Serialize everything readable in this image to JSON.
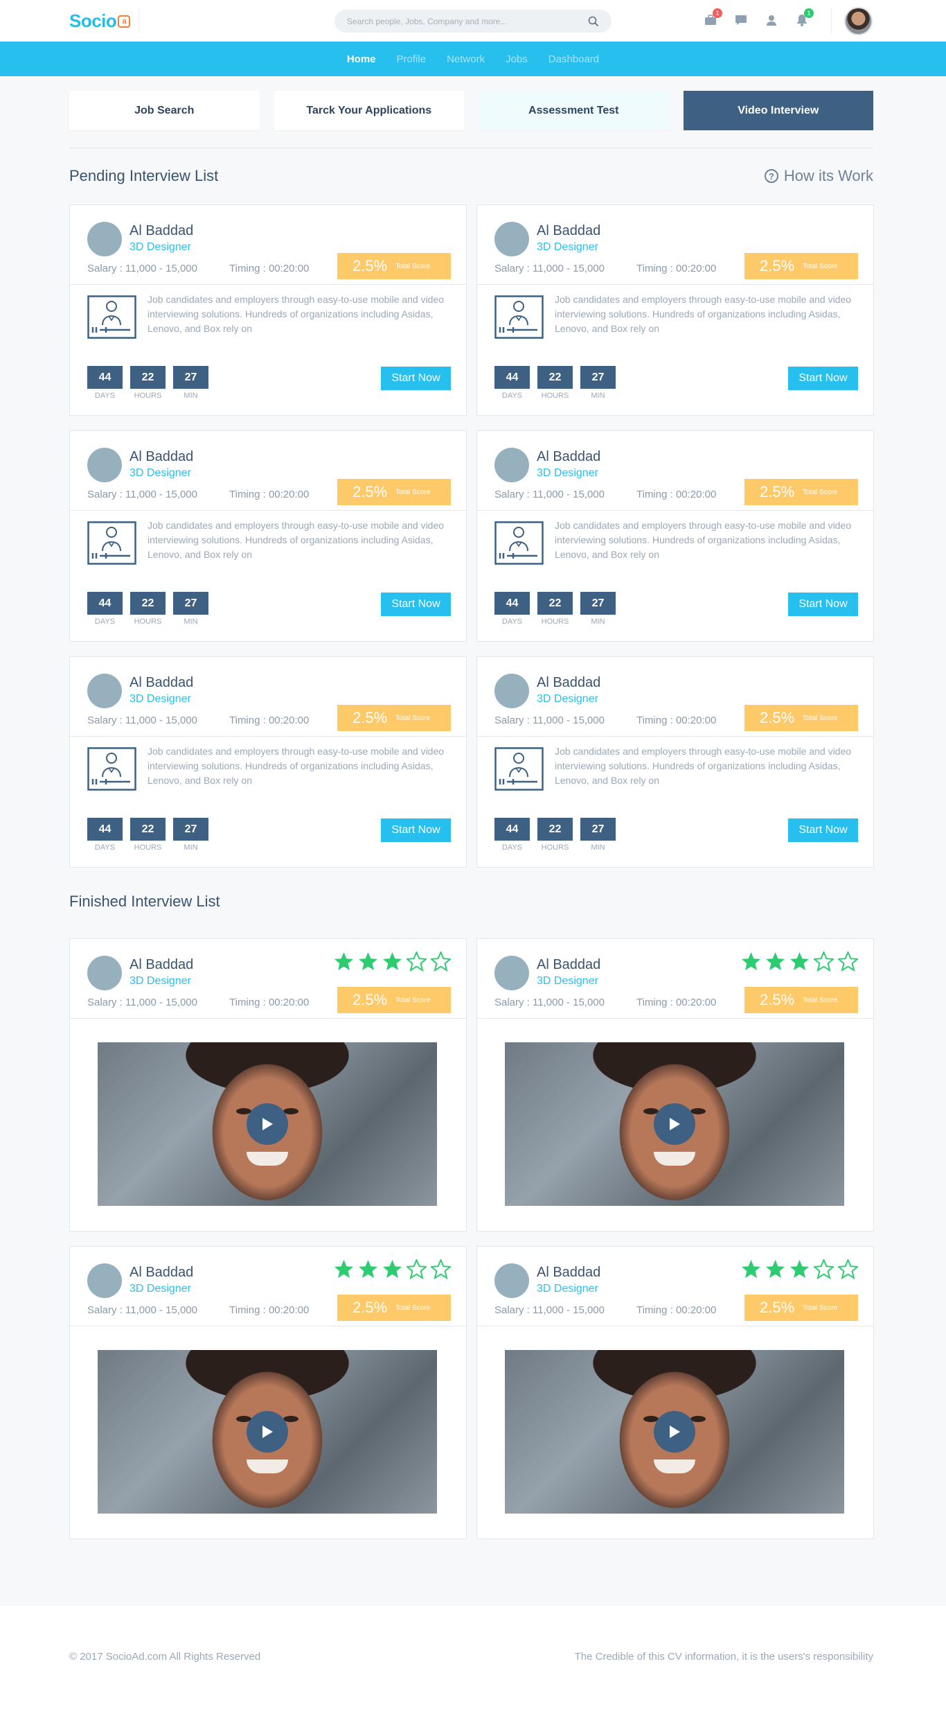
{
  "brand": {
    "logo_text": "Socio",
    "logo_mark": "a"
  },
  "search": {
    "placeholder": "Search people, Jobs, Company and more..."
  },
  "notifications": {
    "jobs_count": "1",
    "alerts_count": "1"
  },
  "nav": [
    "Home",
    "Profile",
    "Network",
    "Jobs",
    "Dashboard"
  ],
  "tabs": [
    "Job Search",
    "Tarck Your Applications",
    "Assessment Test",
    "Video Interview"
  ],
  "pending": {
    "title": "Pending Interview List",
    "how_link": "How its Work"
  },
  "finished": {
    "title": "Finished Interview List"
  },
  "candidate": {
    "name": "Al Baddad",
    "role": "3D Designer",
    "salary": "Salary : 11,000 - 15,000",
    "timing": "Timing : 00:20:00",
    "score": "2.5%",
    "score_label": "Total Score",
    "description": "Job candidates and employers through easy-to-use mobile and video interviewing solutions. Hundreds of organizations including Asidas, Lenovo, and Box rely on",
    "countdown": [
      {
        "value": "44",
        "label": "DAYS"
      },
      {
        "value": "22",
        "label": "HOURS"
      },
      {
        "value": "27",
        "label": "MIN"
      }
    ],
    "start_label": "Start Now",
    "rating": 3,
    "rating_max": 5
  },
  "colors": {
    "accent": "#27c0ee",
    "dark": "#3d6083",
    "score": "#fdc969",
    "star": "#2ecc71"
  },
  "footer": {
    "copyright": "© 2017 SocioAd.com All Rights Reserved",
    "note": "The Credible of this CV information, it is the users's responsibility"
  }
}
